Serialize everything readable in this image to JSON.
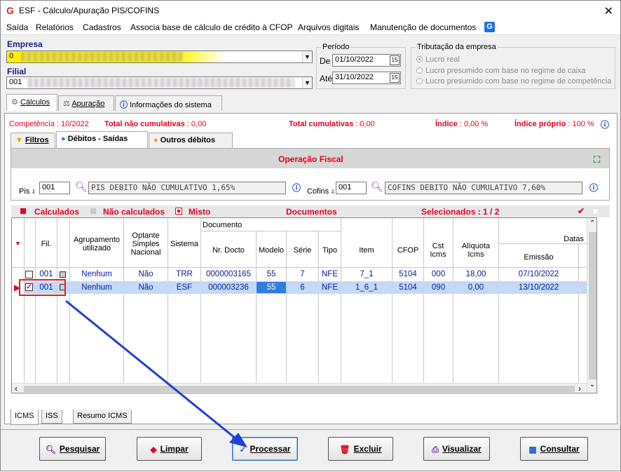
{
  "window": {
    "title": "ESF - Cálculo/Apuração PIS/COFINS",
    "close": "✕"
  },
  "menu": [
    "Saída",
    "Relatórios",
    "Cadastros",
    "Associa base de cálculo de crédito à CFOP",
    "Arquivos digitais",
    "Manutenção de documentos"
  ],
  "empresa": {
    "label": "Empresa",
    "value_prefix": "0",
    "code_prefix": "0"
  },
  "filial": {
    "label": "Filial",
    "value": "001"
  },
  "periodo": {
    "legend": "Período",
    "de_label": "De",
    "de_value": "01/10/2022",
    "ate_label": "Até",
    "ate_value": "31/10/2022"
  },
  "tributacao": {
    "legend": "Tributação da empresa",
    "options": [
      "Lucro real",
      "Lucro presumido com base no regime de caixa",
      "Lucro presumido com base no regime de competência"
    ]
  },
  "main_tabs": [
    "Cálculos",
    "Apuração",
    "Informações do sistema"
  ],
  "status": {
    "competencia": "Competência : 10/2022",
    "total_nao_cum_label": "Total não cumulativas",
    "total_nao_cum_value": ": 0,00",
    "total_cum_label": "Total cumulativas",
    "total_cum_value": ": 0,00",
    "indice_label": "Índice",
    "indice_value": ": 0,00 %",
    "indice_proprio_label": "Índice próprio",
    "indice_proprio_value": ": 100 %"
  },
  "sub_tabs": [
    "Filtros",
    "Débitos - Saídas",
    "Outros débitos"
  ],
  "operacao": {
    "title": "Operação Fiscal",
    "pis_label": "Pis",
    "pis_code": "001",
    "pis_desc": "PIS DEBITO  NÃO CUMULATIVO 1,65%",
    "cofins_label": "Cofins",
    "cofins_code": "001",
    "cofins_desc": "COFINS DEBITO  NÃO CUMULATIVO 7,60%"
  },
  "legend": {
    "calculados": "Calculados",
    "nao_calculados": "Não calculados",
    "misto": "Misto",
    "documentos": "Documentos",
    "selecionados": "Selecionados : 1 / 2"
  },
  "columns": {
    "fil": "Fil.",
    "agrupamento": "Agrupamento utilizado",
    "optante": "Optante Simples Nacional",
    "sistema": "Sistema",
    "documento": "Documento",
    "nr_docto": "Nr. Docto",
    "modelo": "Modelo",
    "serie": "Série",
    "tipo": "Tipo",
    "item": "Item",
    "cfop": "CFOP",
    "cst_icms": "Cst Icms",
    "aliquota": "Alíquota Icms",
    "datas": "Datas",
    "emissao": "Emissão"
  },
  "rows": [
    {
      "fil": "001",
      "agrupamento": "Nenhum",
      "optante": "Não",
      "sistema": "TRR",
      "nr_docto": "0000003165",
      "modelo": "55",
      "serie": "7",
      "tipo": "NFE",
      "item": "7_1",
      "cfop": "5104",
      "cst": "000",
      "aliquota": "18,00",
      "emissao": "07/10/2022",
      "checked": false
    },
    {
      "fil": "001",
      "agrupamento": "Nenhum",
      "optante": "Não",
      "sistema": "ESF",
      "nr_docto": "000003236",
      "modelo": "55",
      "serie": "6",
      "tipo": "NFE",
      "item": "1_6_1",
      "cfop": "5104",
      "cst": "090",
      "aliquota": "0,00",
      "emissao": "13/10/2022",
      "checked": true
    }
  ],
  "bottom_tabs": [
    "ICMS",
    "ISS",
    "Resumo ICMS"
  ],
  "buttons": {
    "pesquisar": "Pesquisar",
    "limpar": "Limpar",
    "processar": "Processar",
    "excluir": "Excluir",
    "visualizar": "Visualizar",
    "consultar": "Consultar"
  },
  "colors": {
    "accent_red": "#e3001b",
    "link_blue": "#001c9e",
    "selection": "#c5d9f7",
    "annotation": "#1f3fd6"
  }
}
